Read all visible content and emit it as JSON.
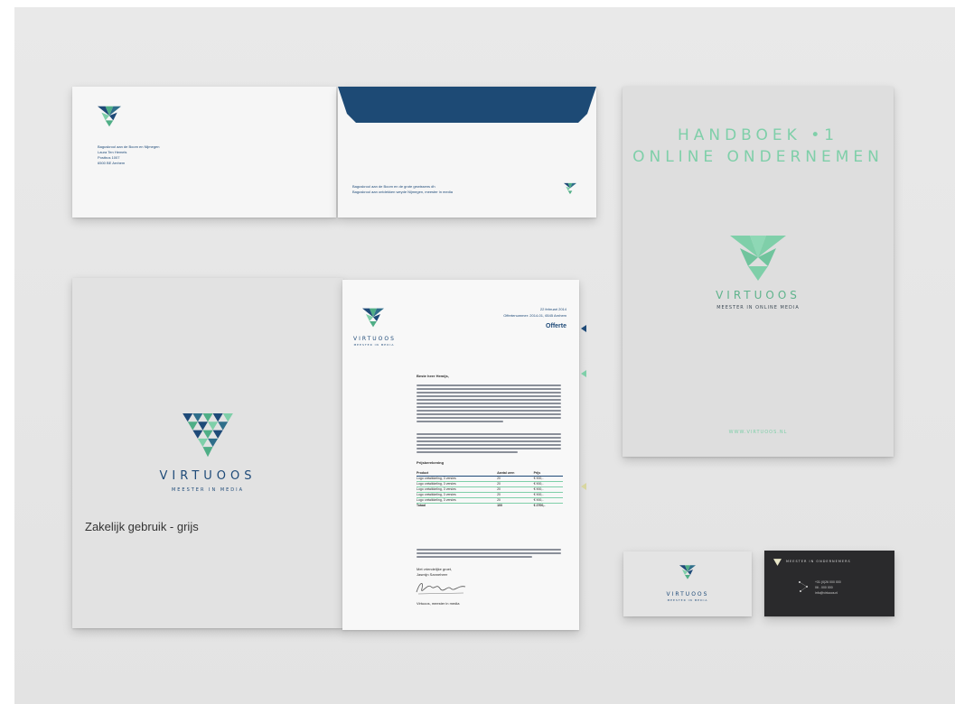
{
  "envelope_back": {
    "address_lines": [
      "Baguskrool aan de Boom en Nijmegen",
      "Laura Ten Hemels",
      "Postbus 1007",
      "6500 BE Arnhem"
    ]
  },
  "envelope_front": {
    "lines": [
      "Baguskrool aan de Boom en de grote gewissens dh",
      "Baguskrool aan ontdekken weyde Nijmegen, meester in media"
    ]
  },
  "handbook": {
    "title_line1": "HANDBOEK •1",
    "title_line2": "ONLINE ONDERNEMEN",
    "brand": "VIRTUOOS",
    "tagline": "MEESTER IN ONLINE MEDIA",
    "website": "WWW.VIRTUOOS.NL"
  },
  "folder": {
    "brand": "VIRTUOOS",
    "tagline": "MEESTER IN MEDIA",
    "caption": "Zakelijk gebruik - grijs"
  },
  "letter": {
    "brand": "VIRTUOOS",
    "tagline": "MEESTER IN MEDIA",
    "date": "22 februari 2014",
    "reference": "Offertenummer: 2014-01, 6545 Arnhem",
    "doc_title": "Offerte",
    "greeting": "Beste heer Hemijs,",
    "table_heading": "Prijsberekening",
    "table_columns": [
      "Product",
      "Aantal uren",
      "Prijs"
    ],
    "table_rows": [
      [
        "Logo ontwikkeling, 3 versies",
        "20",
        "€ 900,-"
      ],
      [
        "Logo ontwikkeling, 3 versies",
        "20",
        "€ 900,-"
      ],
      [
        "Logo ontwikkeling, 3 versies",
        "20",
        "€ 900,-"
      ],
      [
        "Logo ontwikkeling, 3 versies",
        "20",
        "€ 900,-"
      ],
      [
        "Logo ontwikkeling, 3 versies",
        "20",
        "€ 900,-"
      ]
    ],
    "table_total": [
      "Totaal",
      "100",
      "€ 2700,-"
    ],
    "closing": "Met vriendelijke groet,",
    "sender": "Jasmijn Sanneheer",
    "signature_role": "Virtuoos, meester in media"
  },
  "card_front": {
    "brand": "VIRTUOOS",
    "tagline": "MEESTER IN MEDIA"
  },
  "card_back": {
    "header": "MEESTER IN ONDERNEMERS",
    "lines": [
      "+31 (0)26 000 000",
      "06 - 000 000",
      "info@virtuoos.nl"
    ]
  },
  "colors": {
    "navy": "#1e4a78",
    "mint": "#7fcfa9",
    "green": "#4fae86",
    "dark_card": "#2a2a2c",
    "background": "#e6e6e6"
  }
}
